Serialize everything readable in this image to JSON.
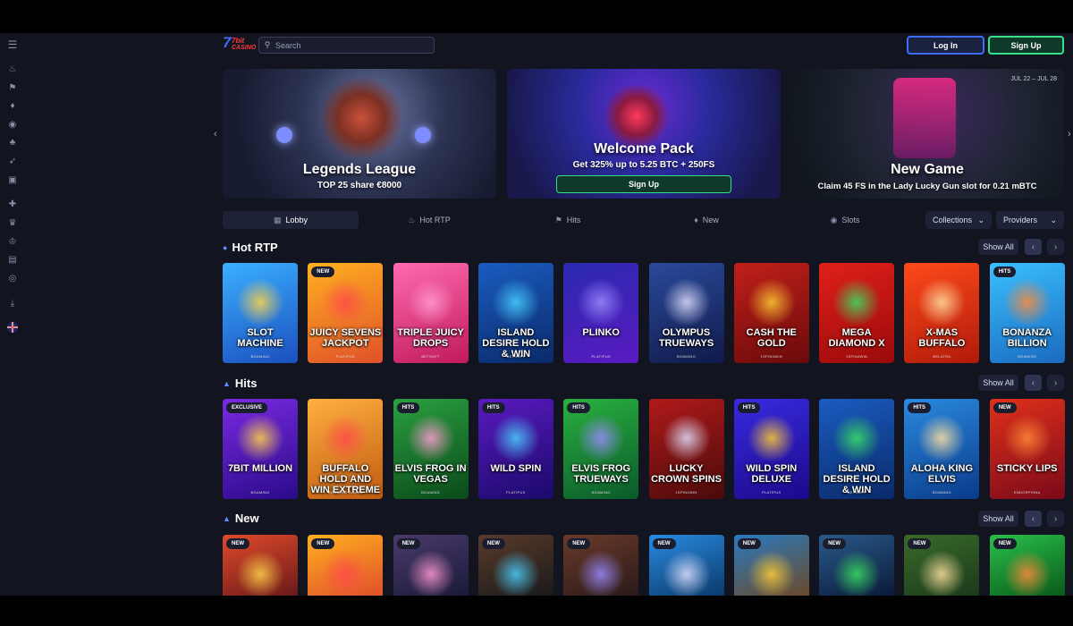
{
  "header": {
    "logo_top": "7bit",
    "logo_bottom": "CASINO",
    "search_placeholder": "Search",
    "login_label": "Log In",
    "signup_label": "Sign Up"
  },
  "sidebar": {
    "icons": [
      "menu-icon",
      "fire-icon",
      "hits-icon",
      "drops-icon",
      "slots-icon",
      "table-games-icon",
      "rocket-icon",
      "live-icon",
      "gift-icon",
      "trophy-icon",
      "crown-icon",
      "cashier-icon",
      "support-icon",
      "download-icon",
      "language-flag-icon"
    ]
  },
  "banners": [
    {
      "title": "Legends League",
      "subtitle": "TOP 25 share €8000"
    },
    {
      "title": "Welcome Pack",
      "subtitle": "Get 325% up to 5.25 BTC + 250FS",
      "cta": "Sign Up"
    },
    {
      "title": "New Game",
      "subtitle": "Claim 45 FS in the Lady Lucky Gun slot for 0.21 mBTC",
      "date": "JUL 22 – JUL 28"
    }
  ],
  "tabs": [
    {
      "label": "Lobby",
      "icon": "lobby-icon"
    },
    {
      "label": "Hot RTP",
      "icon": "fire-icon"
    },
    {
      "label": "Hits",
      "icon": "hits-icon"
    },
    {
      "label": "New",
      "icon": "new-icon"
    },
    {
      "label": "Slots",
      "icon": "slots-icon"
    }
  ],
  "dropdowns": {
    "collections": "Collections",
    "providers": "Providers"
  },
  "show_all": "Show All",
  "sections": [
    {
      "title": "Hot RTP",
      "games": [
        {
          "name": "SLOT MACHINE",
          "provider": "BGAMING",
          "badge": ""
        },
        {
          "name": "JUICY SEVENS JACKPOT",
          "provider": "PLATIPUS",
          "badge": "NEW"
        },
        {
          "name": "TRIPLE JUICY DROPS",
          "provider": "BETSOFT",
          "badge": ""
        },
        {
          "name": "ISLAND DESIRE HOLD & WIN",
          "provider": "BETSOFT",
          "badge": ""
        },
        {
          "name": "PLINKO",
          "provider": "PLATIPUS",
          "badge": ""
        },
        {
          "name": "OLYMPUS TRUEWAYS",
          "provider": "BGAMING",
          "badge": ""
        },
        {
          "name": "CASH THE GOLD",
          "provider": "1SPIN4WIN",
          "badge": ""
        },
        {
          "name": "MEGA DIAMOND X",
          "provider": "1SPIN4WIN",
          "badge": ""
        },
        {
          "name": "X-MAS BUFFALO",
          "provider": "BELATRA",
          "badge": ""
        },
        {
          "name": "BONANZA BILLION",
          "provider": "BGAMING",
          "badge": "HITS"
        }
      ]
    },
    {
      "title": "Hits",
      "games": [
        {
          "name": "7BIT MILLION",
          "provider": "BGAMING",
          "badge": "EXCLUSIVE"
        },
        {
          "name": "BUFFALO HOLD AND WIN EXTREME",
          "provider": "BOOMING GAMES",
          "badge": ""
        },
        {
          "name": "ELVIS FROG IN VEGAS",
          "provider": "BGAMING",
          "badge": "HITS"
        },
        {
          "name": "WILD SPIN",
          "provider": "PLATIPUS",
          "badge": "HITS"
        },
        {
          "name": "ELVIS FROG TRUEWAYS",
          "provider": "BGAMING",
          "badge": "HITS"
        },
        {
          "name": "LUCKY CROWN SPINS",
          "provider": "1SPIN4WIN",
          "badge": ""
        },
        {
          "name": "WILD SPIN DELUXE",
          "provider": "PLATIPUS",
          "badge": "HITS"
        },
        {
          "name": "ISLAND DESIRE HOLD & WIN",
          "provider": "BETSOFT",
          "badge": ""
        },
        {
          "name": "ALOHA KING ELVIS",
          "provider": "BGAMING",
          "badge": "HITS"
        },
        {
          "name": "STICKY LIPS",
          "provider": "ENDORPHINA",
          "badge": "NEW"
        }
      ]
    },
    {
      "title": "New",
      "games": [
        {
          "name": "",
          "provider": "",
          "badge": "NEW"
        },
        {
          "name": "",
          "provider": "",
          "badge": "NEW"
        },
        {
          "name": "",
          "provider": "",
          "badge": "NEW"
        },
        {
          "name": "",
          "provider": "",
          "badge": "NEW"
        },
        {
          "name": "",
          "provider": "",
          "badge": "NEW"
        },
        {
          "name": "",
          "provider": "",
          "badge": "NEW"
        },
        {
          "name": "",
          "provider": "",
          "badge": "NEW"
        },
        {
          "name": "",
          "provider": "",
          "badge": "NEW"
        },
        {
          "name": "",
          "provider": "",
          "badge": "NEW"
        },
        {
          "name": "",
          "provider": "",
          "badge": "NEW"
        }
      ]
    }
  ],
  "colors": {
    "background": "#12141f",
    "panel": "#1d2236",
    "accent_blue": "#3c6dff",
    "accent_green": "#35e08a"
  }
}
